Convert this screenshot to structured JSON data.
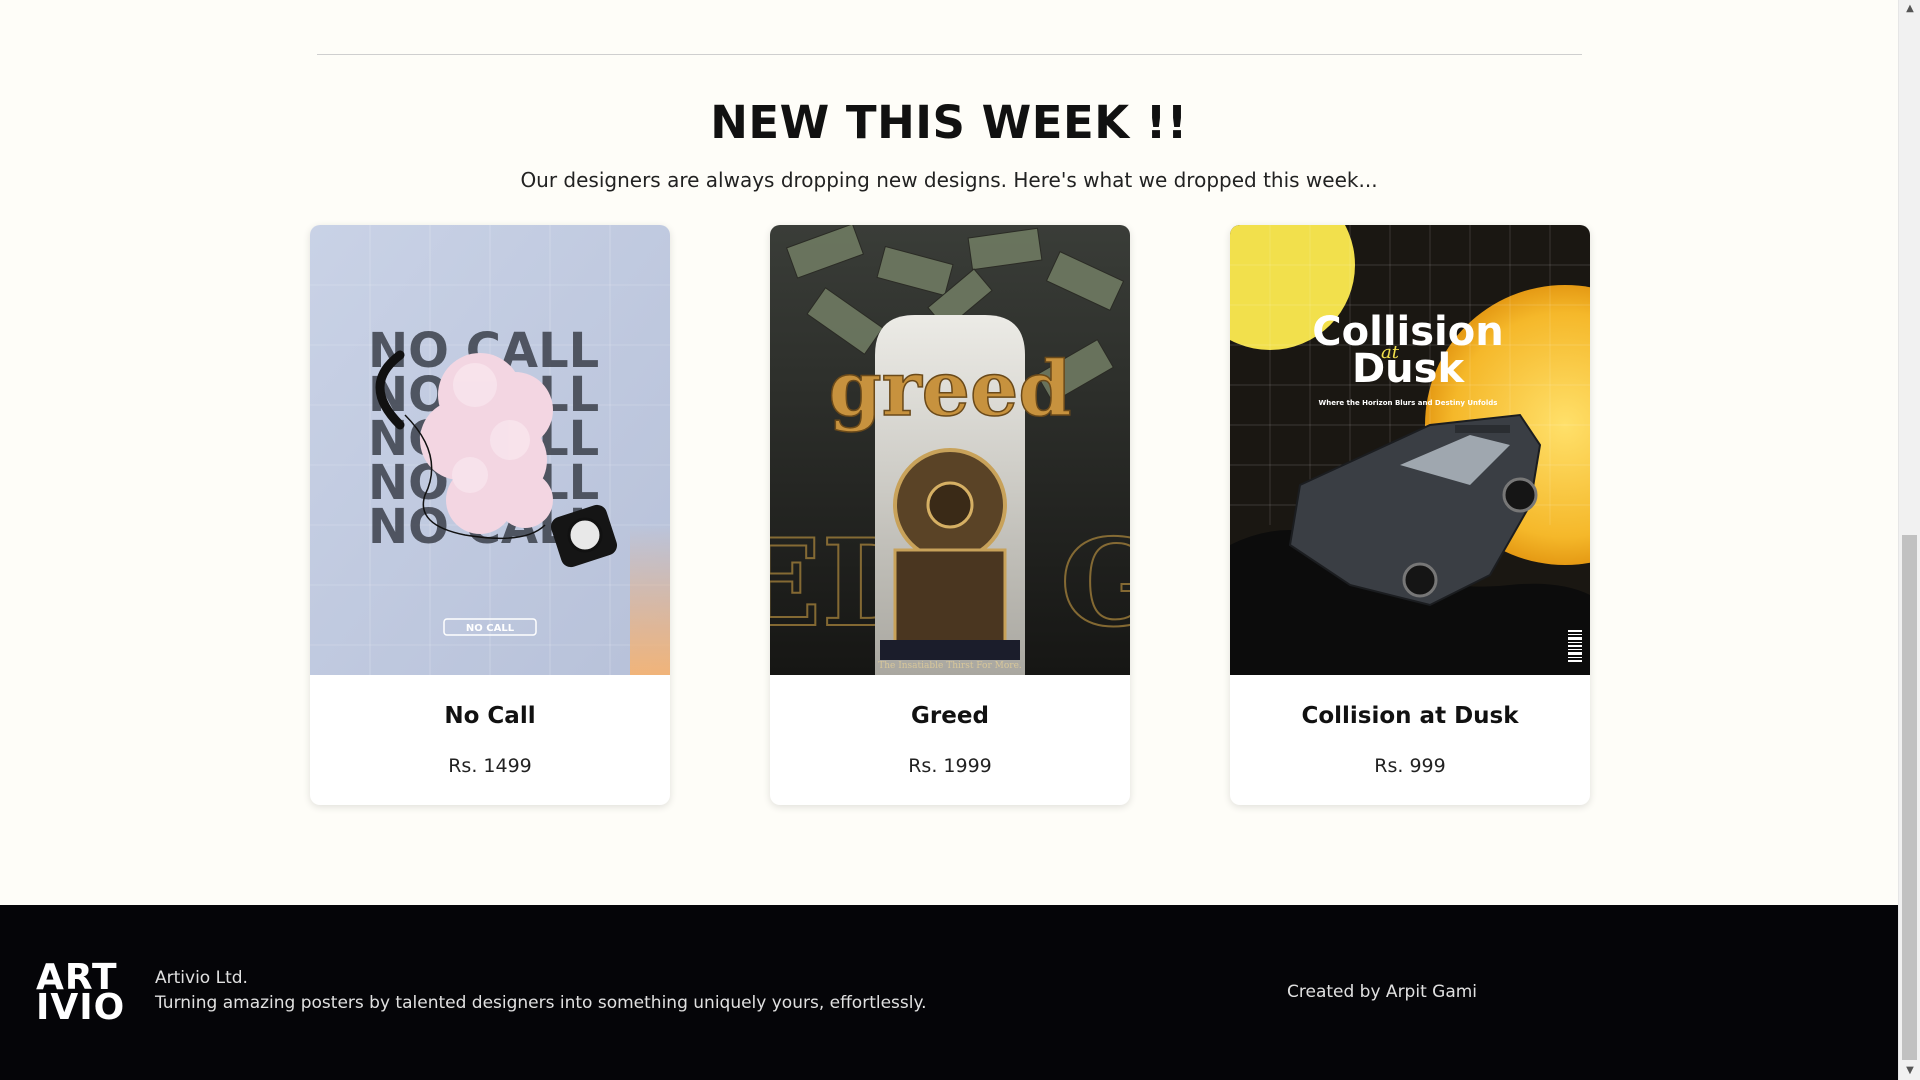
{
  "section": {
    "title": "NEW THIS WEEK !!",
    "subtitle": "Our designers are always dropping new designs. Here's what we dropped this week..."
  },
  "products": [
    {
      "name": "No Call",
      "price": "Rs. 1499",
      "poster_text": "NO CALL",
      "poster_tag": "NO CALL"
    },
    {
      "name": "Greed",
      "price": "Rs. 1999",
      "poster_text": "greed",
      "poster_tag": "The Insatiable Thirst For More."
    },
    {
      "name": "Collision at Dusk",
      "price": "Rs. 999",
      "poster_line1": "Collision",
      "poster_line2": "at",
      "poster_line3": "Dusk",
      "poster_tag": "Where the Horizon Blurs and Destiny Unfolds"
    }
  ],
  "footer": {
    "logo_line1": "ART",
    "logo_line2": "IVIO",
    "company": "Artivio Ltd.",
    "tagline": "Turning amazing posters by talented designers into something uniquely yours, effortlessly.",
    "credit": "Created by Arpit Gami"
  },
  "scrollbar": {
    "up_icon": "▲",
    "down_icon": "▼"
  }
}
